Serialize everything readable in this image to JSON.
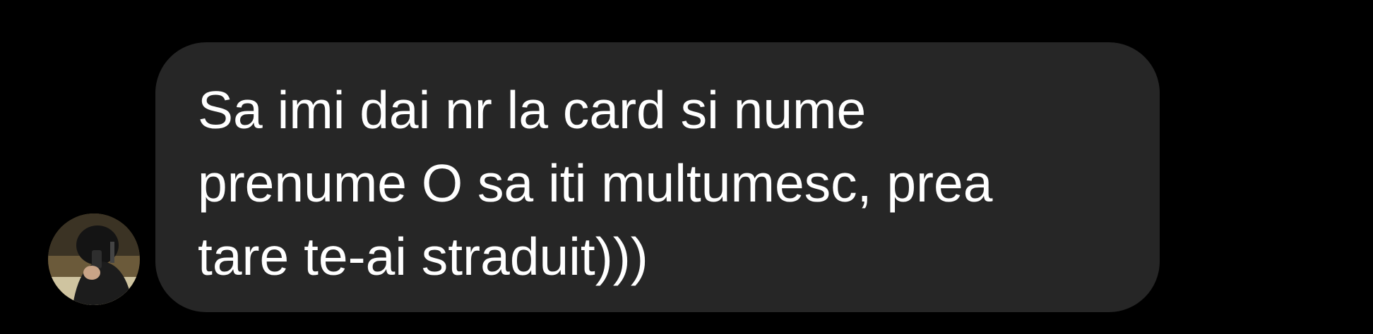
{
  "message": {
    "text": "Sa imi dai nr la card si nume prenume O sa iti multumesc, prea tare te-ai straduit)))",
    "sender_avatar_icon": "user-avatar-photo"
  },
  "colors": {
    "background": "#000000",
    "bubble": "#262626",
    "text": "#ffffff"
  }
}
